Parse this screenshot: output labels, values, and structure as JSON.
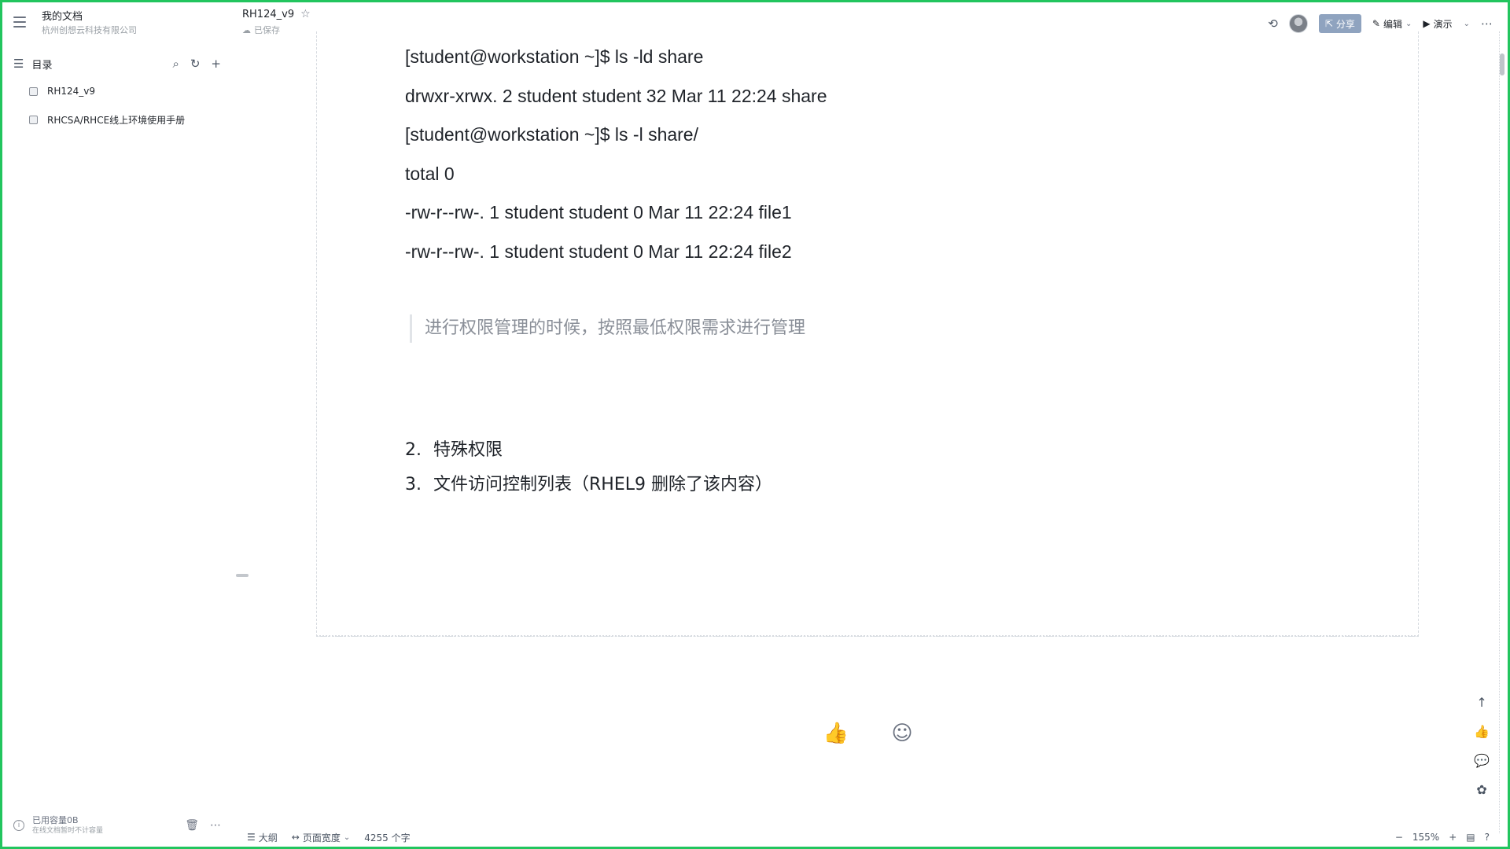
{
  "sidebar": {
    "menu_icon": "hamburger-icon",
    "workspace_title": "我的文档",
    "workspace_sub": "杭州创想云科技有限公司",
    "toc_label": "目录",
    "toc_items": [
      {
        "label": "RH124_v9"
      },
      {
        "label": "RHCSA/RHCE线上环境使用手册"
      }
    ],
    "footer": {
      "storage_main": "已用容量0B",
      "storage_sub": "在线文档暂时不计容量"
    }
  },
  "header": {
    "doc_title": "RH124_v9",
    "saved_status": "已保存",
    "share_label": "分享",
    "edit_label": "编辑",
    "present_label": "演示"
  },
  "document": {
    "code_lines": [
      "[student@workstation ~]$ ls -ld share",
      "drwxr-xrwx. 2 student student 32 Mar 11 22:24 share",
      "[student@workstation ~]$ ls -l share/",
      "total 0",
      "-rw-r--rw-. 1 student student 0 Mar 11 22:24 file1",
      "-rw-r--rw-. 1 student student 0 Mar 11 22:24 file2"
    ],
    "quote": "进行权限管理的时候，按照最低权限需求进行管理",
    "list": [
      {
        "num": "2.",
        "text": "特殊权限"
      },
      {
        "num": "3.",
        "text": "文件访问控制列表（RHEL9 删除了该内容）"
      }
    ]
  },
  "statusbar": {
    "outline_label": "大纲",
    "page_width_label": "页面宽度",
    "word_count": "4255 个字"
  },
  "zoom": {
    "level": "155%"
  }
}
